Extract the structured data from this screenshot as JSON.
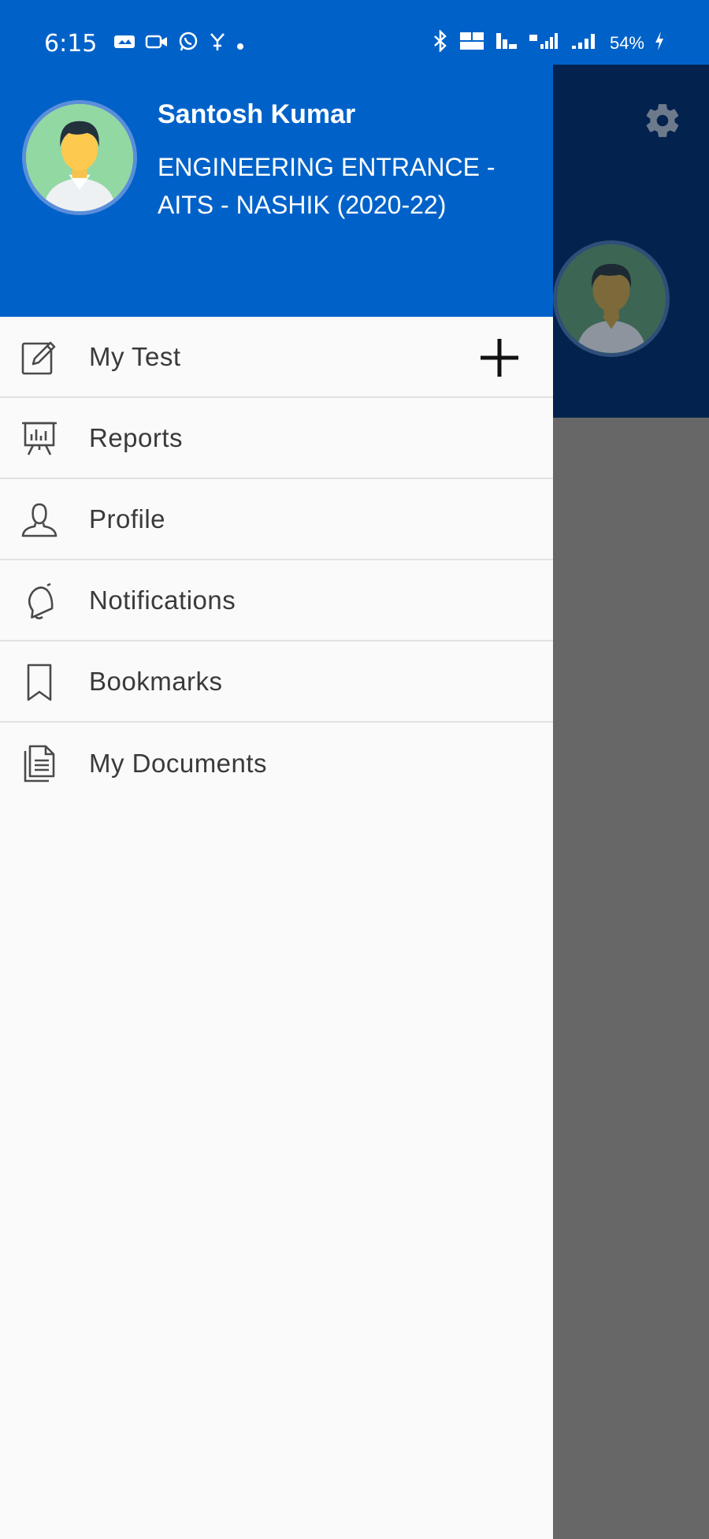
{
  "status_bar": {
    "time": "6:15",
    "battery": "54%"
  },
  "user": {
    "name": "Santosh Kumar",
    "course": "ENGINEERING ENTRANCE - AITS - NASHIK (2020-22)"
  },
  "menu": {
    "items": [
      {
        "label": "My Test",
        "icon": "edit-icon"
      },
      {
        "label": "Reports",
        "icon": "presentation-chart-icon"
      },
      {
        "label": "Profile",
        "icon": "user-icon"
      },
      {
        "label": "Notifications",
        "icon": "bell-icon"
      },
      {
        "label": "Bookmarks",
        "icon": "bookmark-icon"
      },
      {
        "label": "My Documents",
        "icon": "document-icon"
      }
    ]
  },
  "colors": {
    "primary": "#0062c9",
    "dark_header": "#03234e",
    "scrim": "#676767",
    "drawer_bg": "#fafafa"
  }
}
